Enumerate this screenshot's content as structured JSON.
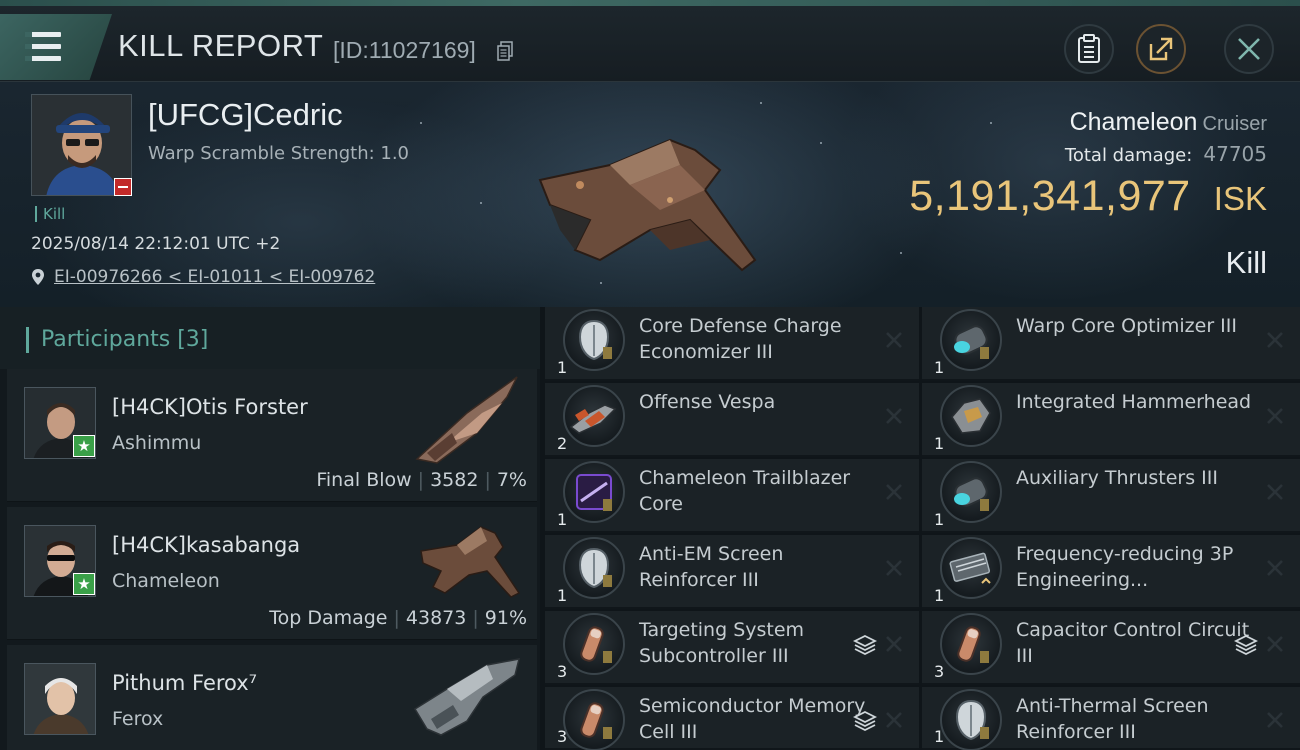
{
  "header": {
    "title": "KILL REPORT",
    "report_id": "[ID:11027169]"
  },
  "victim": {
    "name": "[UFCG]Cedric",
    "warp_scramble": "Warp Scramble Strength: 1.0",
    "tag": "Kill",
    "datetime": "2025/08/14 22:12:01 UTC +2",
    "location": "EI-00976266 < EI-01011 < EI-009762",
    "ship_name": "Chameleon",
    "ship_class": "Cruiser",
    "total_damage_label": "Total damage:",
    "total_damage": "47705",
    "isk_value": "5,191,341,977",
    "isk_unit": "ISK",
    "result": "Kill"
  },
  "participants": {
    "title": "Participants [3]",
    "rows": [
      {
        "name": "[H4CK]Otis Forster",
        "ship": "Ashimmu",
        "stats_label": "Final Blow",
        "damage": "3582",
        "percent": "7%"
      },
      {
        "name": "[H4CK]kasabanga",
        "ship": "Chameleon",
        "stats_label": "Top Damage",
        "damage": "43873",
        "percent": "91%"
      },
      {
        "name": "Pithum Ferox⁷",
        "ship": "Ferox",
        "stats_label": "",
        "damage": "",
        "percent": ""
      }
    ]
  },
  "modules": [
    {
      "name": "Core Defense Charge Economizer III",
      "qty": "1",
      "icon": "shield-module-icon",
      "color": "#8fc7c9"
    },
    {
      "name": "Warp Core Optimizer III",
      "qty": "1",
      "icon": "engine-module-icon",
      "color": "#49d4e0"
    },
    {
      "name": "Offense  Vespa",
      "qty": "2",
      "icon": "drone-vespa-icon",
      "color": "#c9562c"
    },
    {
      "name": "Integrated Hammerhead",
      "qty": "1",
      "icon": "drone-hammerhead-icon",
      "color": "#c89a4a"
    },
    {
      "name": "Chameleon Trailblazer Core",
      "qty": "1",
      "icon": "core-chip-icon",
      "color": "#7a4bd0"
    },
    {
      "name": "Auxiliary Thrusters III",
      "qty": "1",
      "icon": "thruster-module-icon",
      "color": "#49d4e0"
    },
    {
      "name": "Anti-EM Screen Reinforcer III",
      "qty": "1",
      "icon": "shield-module-icon",
      "color": "#8fc7c9"
    },
    {
      "name": "Frequency-reducing 3P Engineering...",
      "qty": "1",
      "icon": "engineering-rig-icon",
      "color": "#a9b4ba"
    },
    {
      "name": "Targeting System Subcontroller III",
      "qty": "3",
      "icon": "capacitor-module-icon",
      "color": "#c98a6a"
    },
    {
      "name": "Capacitor Control Circuit III",
      "qty": "3",
      "icon": "capacitor-module-icon",
      "color": "#c98a6a"
    },
    {
      "name": "Semiconductor Memory Cell III",
      "qty": "3",
      "icon": "capacitor-module-icon",
      "color": "#c98a6a"
    },
    {
      "name": "Anti-Thermal Screen Reinforcer III",
      "qty": "1",
      "icon": "shield-module-icon",
      "color": "#8fc7c9"
    }
  ],
  "colors": {
    "accent": "#5fa89c",
    "isk": "#e9c57a"
  }
}
